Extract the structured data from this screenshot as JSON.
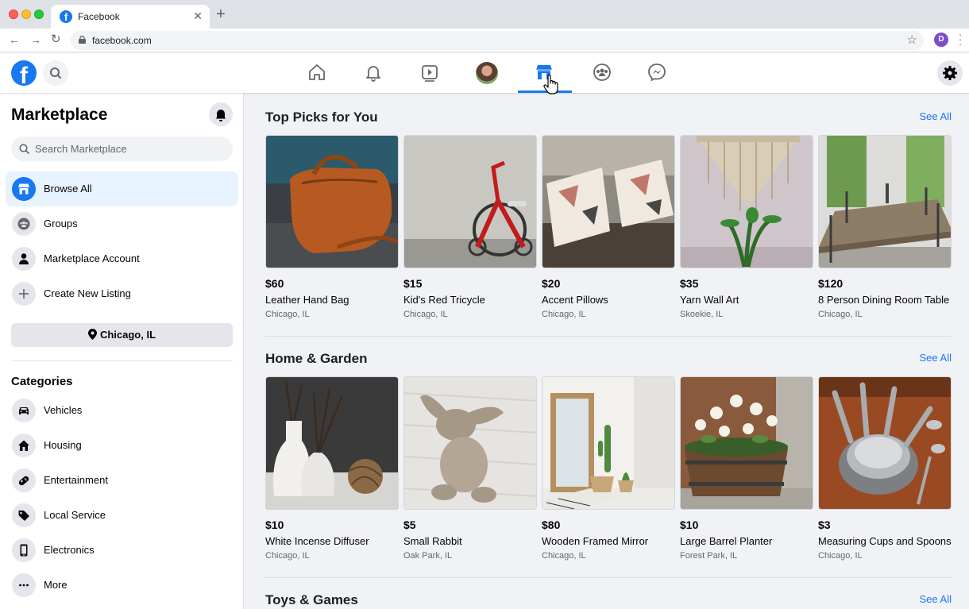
{
  "browser": {
    "tab_title": "Facebook",
    "url": "facebook.com",
    "profile_initial": "D"
  },
  "colors": {
    "brand": "#1877f2",
    "background": "#f0f2f5",
    "secondary_text": "#65676b"
  },
  "sidebar": {
    "title": "Marketplace",
    "search_placeholder": "Search Marketplace",
    "nav": [
      {
        "label": "Browse All",
        "icon": "storefront-icon"
      },
      {
        "label": "Groups",
        "icon": "groups-icon"
      },
      {
        "label": "Marketplace Account",
        "icon": "person-icon"
      },
      {
        "label": "Create New Listing",
        "icon": "plus-icon"
      }
    ],
    "location": "Chicago, IL",
    "categories_title": "Categories",
    "categories": [
      {
        "label": "Vehicles",
        "icon": "car-icon"
      },
      {
        "label": "Housing",
        "icon": "house-icon"
      },
      {
        "label": "Entertainment",
        "icon": "gamepad-icon"
      },
      {
        "label": "Local Service",
        "icon": "tag-icon"
      },
      {
        "label": "Electronics",
        "icon": "phone-icon"
      },
      {
        "label": "More",
        "icon": "more-dots-icon"
      }
    ]
  },
  "sections": [
    {
      "title": "Top Picks for You",
      "see_all": "See All",
      "items": [
        {
          "price": "$60",
          "title": "Leather Hand Bag",
          "location": "Chicago, IL"
        },
        {
          "price": "$15",
          "title": "Kid's Red Tricycle",
          "location": "Chicago, IL"
        },
        {
          "price": "$20",
          "title": "Accent Pillows",
          "location": "Chicago, IL"
        },
        {
          "price": "$35",
          "title": "Yarn Wall Art",
          "location": "Skoekie, IL"
        },
        {
          "price": "$120",
          "title": "8 Person Dining Room Table",
          "location": "Chicago, IL"
        }
      ]
    },
    {
      "title": "Home & Garden",
      "see_all": "See All",
      "items": [
        {
          "price": "$10",
          "title": "White Incense Diffuser",
          "location": "Chicago, IL"
        },
        {
          "price": "$5",
          "title": "Small Rabbit",
          "location": "Oak Park, IL"
        },
        {
          "price": "$80",
          "title": "Wooden Framed Mirror",
          "location": "Chicago, IL"
        },
        {
          "price": "$10",
          "title": "Large Barrel Planter",
          "location": "Forest Park, IL"
        },
        {
          "price": "$3",
          "title": "Measuring Cups and Spoons",
          "location": "Chicago, IL"
        }
      ]
    },
    {
      "title": "Toys & Games",
      "see_all": "See All"
    }
  ]
}
